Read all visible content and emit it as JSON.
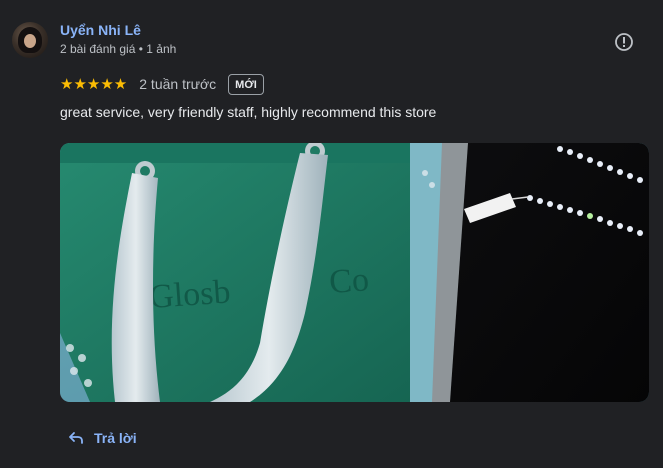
{
  "review": {
    "author_name": "Uyển Nhi Lê",
    "author_meta": "2 bài đánh giá • 1 ảnh",
    "stars": "★★★★★",
    "rating": 5,
    "time": "2 tuần trước",
    "badge": "MỚI",
    "text": "great service, very friendly staff, highly recommend this store",
    "photo_brand_text": "Glosb & Co"
  },
  "actions": {
    "reply_label": "Trả lời",
    "info_icon": "info-icon",
    "reply_icon": "reply-arrow-icon"
  },
  "colors": {
    "background": "#202124",
    "link": "#8ab4f8",
    "star": "#fbbc04",
    "bag_green": "#1f7a63"
  }
}
